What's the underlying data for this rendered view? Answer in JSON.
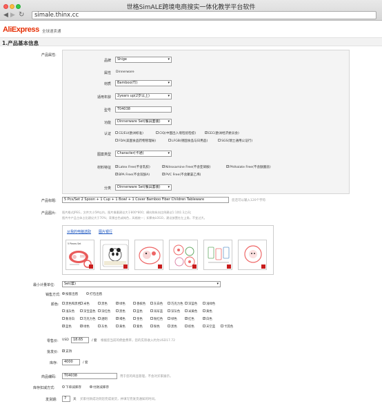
{
  "browser": {
    "window_title": "世格SimALE跨境电商搜实一体化教学平台软件",
    "url": "simale.thinx.cc"
  },
  "header": {
    "logo_text": "AliExpress",
    "logo_sub": "全球速卖通",
    "brand_color": "#e62e04"
  },
  "section": {
    "title": "1.产品基本信息"
  },
  "attributes": {
    "label": "产品属性:",
    "brand": {
      "label": "品牌",
      "value": "Shige"
    },
    "type": {
      "label": "属性",
      "value": "Dinnerware"
    },
    "material": {
      "label": "材质",
      "value": "Bamboo(竹)"
    },
    "age": {
      "label": "适用年龄",
      "value": "2years up(2岁以上)"
    },
    "model": {
      "label": "型号",
      "value": "T04038"
    },
    "function": {
      "label": "功能",
      "value": "Dinnerware Set(餐具套装)"
    },
    "cert": {
      "label": "认证",
      "options": [
        {
          "text": "CE/EU(欧洲标准)",
          "checked": false
        },
        {
          "text": "CIQ(中国出入境检验检疫)",
          "checked": false
        },
        {
          "text": "EEC(欧洲经济委员会)",
          "checked": true
        },
        {
          "text": "FDA(美国食品药物管理局)",
          "checked": false
        },
        {
          "text": "LFGB(德国食品与日用品)",
          "checked": false
        },
        {
          "text": "SGS(瑞士通用公证行)",
          "checked": false
        }
      ]
    },
    "pattern": {
      "label": "图案类型",
      "value": "Character(卡通)"
    },
    "feature": {
      "label": "材料特征",
      "options": [
        {
          "text": "Latex Free(不含乳胶)",
          "checked": true
        },
        {
          "text": "Nitrosamine Free(不含亚硝胺)",
          "checked": true
        },
        {
          "text": "Phthalate Free(不含酞酸盐)",
          "checked": true
        },
        {
          "text": "BPA Free(不含双酚A)",
          "checked": true
        },
        {
          "text": "PVC Free(不含聚氯乙烯)",
          "checked": true
        }
      ]
    },
    "category": {
      "label": "分类",
      "value": "Dinnerware Set(餐具套装)"
    }
  },
  "product_title": {
    "label": "产品标题:",
    "value": "5 Pcs/Set 2 Spoon + 1 Cup + 1 Bowl + 1 Cover Bamboo Fiber Children Tableware",
    "hint": "您还可以输入120个字符"
  },
  "product_images": {
    "label": "产品图片:",
    "hint1": "图片格式JPEG，文件大小5M以内，图片像素建议大于800*800；横向和纵向比例建议1:1到1:3之间；",
    "hint2": "图片中产品主体占比建议大于70%；背景白色或纯色，风格统一；如果有LOGO，建议放置在左上角，不宜过大。",
    "link_local": "从我的电脑选取",
    "link_lib": "图片银行",
    "thumbs": [
      {
        "name": "product-photo-1",
        "label": "5 Pieces Set"
      },
      {
        "name": "product-photo-2",
        "label": ""
      },
      {
        "name": "product-photo-3",
        "label": ""
      },
      {
        "name": "product-photo-4",
        "label": ""
      },
      {
        "name": "product-photo-5",
        "label": ""
      },
      {
        "name": "product-photo-6",
        "label": ""
      }
    ]
  },
  "unit": {
    "label": "最小计量单位:",
    "value": "Set(套)"
  },
  "sale_method": {
    "label": "销售方式:",
    "opt1": "按套出售",
    "opt2": "打包出售"
  },
  "colors": {
    "label": "颜色:",
    "options": [
      [
        "黑色和黑色",
        "米色",
        "黑色",
        "绿色",
        "香槟色",
        "灰白色",
        "巧克力色",
        "深蓝色",
        "浅绿色"
      ],
      [
        "浅灰色",
        "深宝蓝色",
        "深红色",
        "黑色",
        "蓝色",
        "海军蓝",
        "深灰色",
        "米黄色",
        "黄色"
      ],
      [
        "象牙白",
        "巧克力色",
        "透明",
        "褐色",
        "金色",
        "粉红色",
        "绿色",
        "红色",
        "白色"
      ],
      [
        "蓝色",
        "绿色",
        "灰色",
        "黄色",
        "紫色",
        "粉色",
        "黑色",
        "棕色",
        "天空蓝",
        "卡其色"
      ]
    ],
    "checked": [
      [
        0,
        3
      ],
      [
        2,
        3
      ],
      [
        2,
        7
      ],
      [
        2,
        8
      ],
      [
        3,
        0
      ],
      [
        3,
        1
      ]
    ]
  },
  "price": {
    "label": "零售价:",
    "currency": "USD",
    "value": "18.65",
    "unit": "/ 套",
    "hint": "根据您当前的佣金费率，您的实际收入约为USD17.72"
  },
  "wholesale": {
    "label": "批发价:",
    "option": "支持"
  },
  "stock": {
    "label": "库存:",
    "value": "4000",
    "unit": "/ 套"
  },
  "sku": {
    "label": "商品编码:",
    "value": "T04038",
    "hint": "用于您的商品管理，不会对买家展示。"
  },
  "stock_deduct": {
    "label": "库存扣减方式:",
    "opt1": "下单减库存",
    "opt2": "付款减库存"
  },
  "delivery": {
    "label": "发货期:",
    "value": "7",
    "unit": "天",
    "hint": "买家付款成功到您完成发货，并填写完发货通知的时间。"
  }
}
